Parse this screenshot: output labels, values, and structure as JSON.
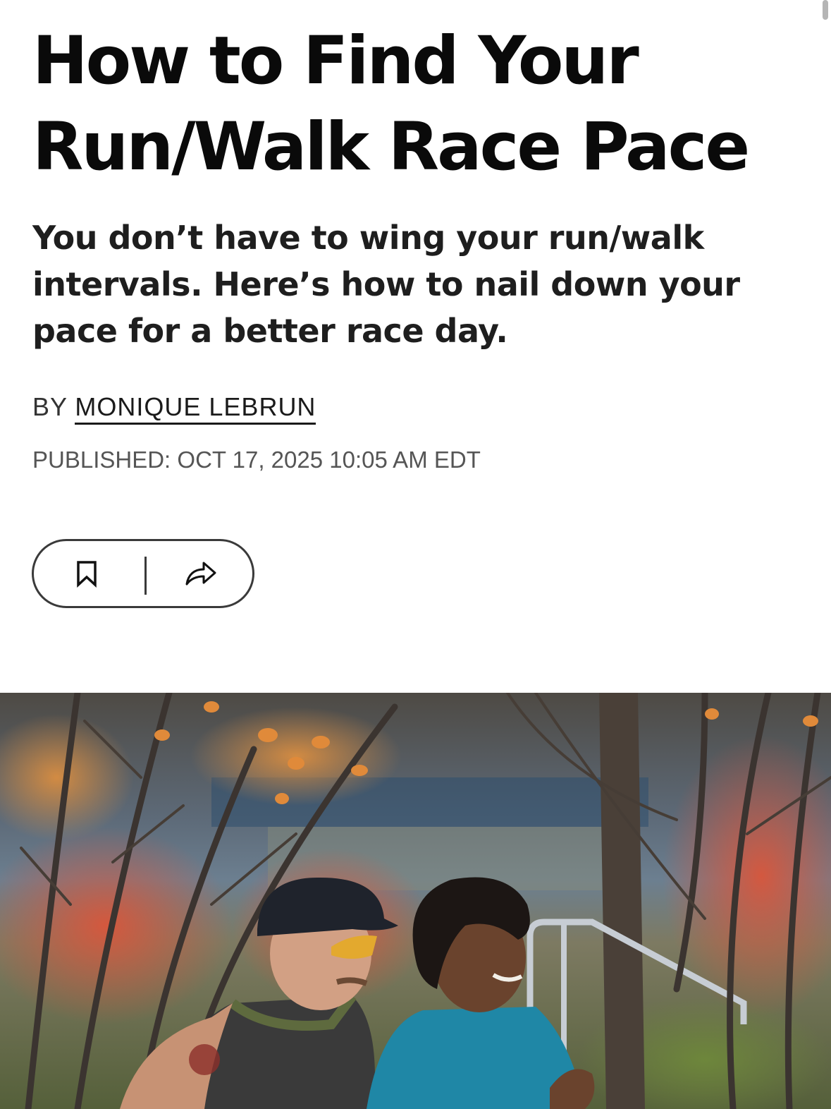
{
  "article": {
    "headline_line1": "How to Find Your",
    "headline_line2": "Run/Walk Race Pace",
    "dek": "You don’t have to wing your run/walk intervals. Here’s how to nail down your pace for a better race day.",
    "byline_prefix": "BY",
    "author": "MONIQUE LEBRUN",
    "published": "PUBLISHED: OCT 17, 2025 10:05 AM EDT"
  },
  "actions": {
    "bookmark_icon": "bookmark-icon",
    "share_icon": "share-icon"
  },
  "hero": {
    "image_subject": "two-runners-autumn-photo"
  }
}
